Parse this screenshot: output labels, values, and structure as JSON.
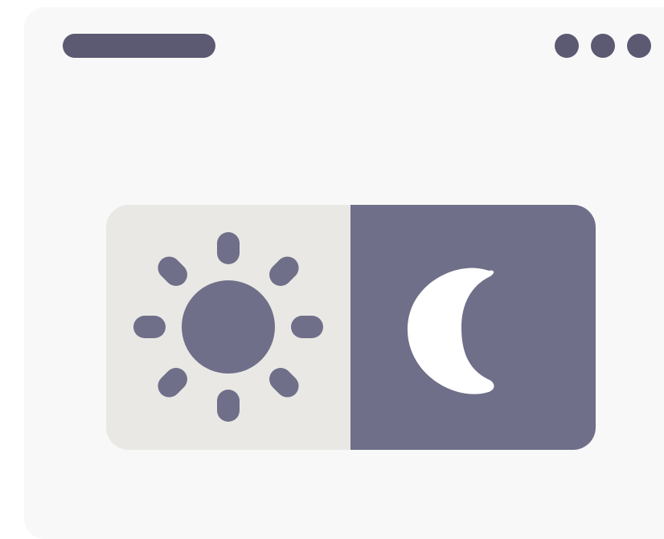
{
  "window": {
    "title_placeholder": "title-bar-placeholder",
    "menu_dots": 3
  },
  "theme_toggle": {
    "options": [
      {
        "mode": "light",
        "icon": "sun-icon",
        "selected": false
      },
      {
        "mode": "dark",
        "icon": "moon-icon",
        "selected": true
      }
    ]
  },
  "colors": {
    "window_bg": "#f8f8f8",
    "chrome": "#5c5a72",
    "light_panel_bg": "#e9e8e4",
    "dark_panel_bg": "#6f6f89",
    "sun": "#6f6f89",
    "moon": "#ffffff"
  }
}
